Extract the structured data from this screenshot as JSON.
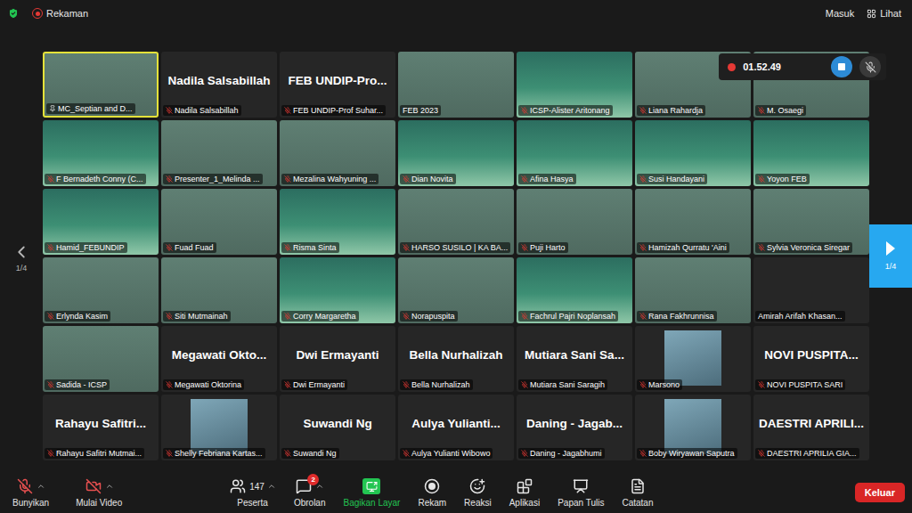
{
  "top_bar": {
    "recording_label": "Rekaman",
    "recording": true,
    "buttons": [
      "Masuk",
      "Lihat"
    ]
  },
  "recording": {
    "time": "01.52.49",
    "recording": true,
    "muted": true
  },
  "pager": {
    "left": "1/4",
    "right": "1/4"
  },
  "tiles": [
    {
      "label": "MC_Septian and D...",
      "kind": "video",
      "speaking": true,
      "pinned": true,
      "muted": false
    },
    {
      "label": "Nadila Salsabillah",
      "name": "Nadila Salsabillah",
      "kind": "name",
      "speaking": false,
      "pinned": false,
      "muted": true
    },
    {
      "label": "FEB UNDIP-Prof Suhar...",
      "name": "FEB UNDIP-Pro...",
      "kind": "name",
      "speaking": false,
      "pinned": false,
      "muted": true
    },
    {
      "label": "FEB 2023",
      "kind": "video",
      "speaking": false,
      "pinned": false,
      "muted": false
    },
    {
      "label": "ICSP-Alister Aritonang",
      "kind": "background",
      "speaking": false,
      "pinned": false,
      "muted": true
    },
    {
      "label": "Liana Rahardja",
      "kind": "video",
      "speaking": false,
      "pinned": false,
      "muted": true
    },
    {
      "label": "M. Osaegi",
      "kind": "video",
      "speaking": false,
      "pinned": false,
      "muted": true
    },
    {
      "label": "F Bernadeth Conny (C...",
      "kind": "background",
      "speaking": false,
      "pinned": false,
      "muted": true
    },
    {
      "label": "Presenter_1_Melinda ...",
      "kind": "video",
      "speaking": false,
      "pinned": false,
      "muted": true
    },
    {
      "label": "Mezalina Wahyuning ...",
      "kind": "video",
      "speaking": false,
      "pinned": false,
      "muted": true
    },
    {
      "label": "Dian Novita",
      "kind": "background",
      "speaking": false,
      "pinned": false,
      "muted": true
    },
    {
      "label": "Afina Hasya",
      "kind": "background",
      "speaking": false,
      "pinned": false,
      "muted": true
    },
    {
      "label": "Susi Handayani",
      "kind": "background",
      "speaking": false,
      "pinned": false,
      "muted": true
    },
    {
      "label": "Yoyon FEB",
      "kind": "background",
      "speaking": false,
      "pinned": false,
      "muted": true
    },
    {
      "label": "Hamid_FEBUNDIP",
      "kind": "background",
      "speaking": false,
      "pinned": false,
      "muted": true
    },
    {
      "label": "Fuad Fuad",
      "kind": "video",
      "speaking": false,
      "pinned": false,
      "muted": true
    },
    {
      "label": "Risma Sinta",
      "kind": "background",
      "speaking": false,
      "pinned": false,
      "muted": true
    },
    {
      "label": "HARSO SUSILO | KA BA...",
      "kind": "video",
      "speaking": false,
      "pinned": false,
      "muted": true
    },
    {
      "label": "Puji Harto",
      "kind": "video",
      "speaking": false,
      "pinned": false,
      "muted": true
    },
    {
      "label": "Hamizah Qurratu 'Aini",
      "kind": "video",
      "speaking": false,
      "pinned": false,
      "muted": true
    },
    {
      "label": "Sylvia Veronica Siregar",
      "kind": "video",
      "speaking": false,
      "pinned": false,
      "muted": true
    },
    {
      "label": "Erlynda Kasim",
      "kind": "video",
      "speaking": false,
      "pinned": false,
      "muted": true
    },
    {
      "label": "Siti Mutmainah",
      "kind": "video",
      "speaking": false,
      "pinned": false,
      "muted": true
    },
    {
      "label": "Corry Margaretha",
      "kind": "background",
      "speaking": false,
      "pinned": false,
      "muted": true
    },
    {
      "label": "Norapuspita",
      "kind": "video",
      "speaking": false,
      "pinned": false,
      "muted": true
    },
    {
      "label": "Fachrul Pajri Noplansah",
      "kind": "background",
      "speaking": false,
      "pinned": false,
      "muted": true
    },
    {
      "label": "Rana Fakhrunnisa",
      "kind": "video",
      "speaking": false,
      "pinned": false,
      "muted": true
    },
    {
      "label": "Amirah Arifah Khasan...",
      "kind": "blank",
      "speaking": false,
      "pinned": false,
      "muted": false
    },
    {
      "label": "Sadida - ICSP",
      "kind": "video",
      "speaking": false,
      "pinned": false,
      "muted": true
    },
    {
      "label": "Megawati Oktorina",
      "name": "Megawati Okto...",
      "kind": "name",
      "speaking": false,
      "pinned": false,
      "muted": true
    },
    {
      "label": "Dwi Ermayanti",
      "name": "Dwi Ermayanti",
      "kind": "name",
      "speaking": false,
      "pinned": false,
      "muted": true
    },
    {
      "label": "Bella Nurhalizah",
      "name": "Bella Nurhalizah",
      "kind": "name",
      "speaking": false,
      "pinned": false,
      "muted": true
    },
    {
      "label": "Mutiara Sani Saragih",
      "name": "Mutiara Sani Sa...",
      "kind": "name",
      "speaking": false,
      "pinned": false,
      "muted": true
    },
    {
      "label": "Marsono",
      "kind": "avatar",
      "speaking": false,
      "pinned": false,
      "muted": true
    },
    {
      "label": "NOVI PUSPITA SARI",
      "name": "NOVI PUSPITA...",
      "kind": "name",
      "speaking": false,
      "pinned": false,
      "muted": true
    },
    {
      "label": "Rahayu Safitri Mutmai...",
      "name": "Rahayu Safitri...",
      "kind": "name",
      "speaking": false,
      "pinned": false,
      "muted": true
    },
    {
      "label": "Shelly Febriana Kartas...",
      "kind": "avatar",
      "speaking": false,
      "pinned": false,
      "muted": true
    },
    {
      "label": "Suwandi Ng",
      "name": "Suwandi Ng",
      "kind": "name",
      "speaking": false,
      "pinned": false,
      "muted": true
    },
    {
      "label": "Aulya Yulianti Wibowo",
      "name": "Aulya Yulianti...",
      "kind": "name",
      "speaking": false,
      "pinned": false,
      "muted": true
    },
    {
      "label": "Daning - Jagabhumi",
      "name": "Daning - Jagab...",
      "kind": "name",
      "speaking": false,
      "pinned": false,
      "muted": true
    },
    {
      "label": "Boby Wiryawan Saputra",
      "kind": "avatar",
      "speaking": false,
      "pinned": false,
      "muted": true
    },
    {
      "label": "DAESTRI APRILIA GIA...",
      "name": "DAESTRI APRILI...",
      "kind": "name",
      "speaking": false,
      "pinned": false,
      "muted": true
    }
  ],
  "toolbar": {
    "left": [
      {
        "label": "Bunyikan",
        "off": true,
        "menu": true
      },
      {
        "label": "Mulai Video",
        "off": true,
        "menu": true
      }
    ],
    "center": [
      {
        "label": "Peserta",
        "count": "147",
        "badge": "",
        "menu": true,
        "active": false
      },
      {
        "label": "Obrolan",
        "count": "",
        "badge": "2",
        "menu": true,
        "active": false
      },
      {
        "label": "Bagikan Layar",
        "count": "",
        "badge": "",
        "menu": false,
        "active": true
      },
      {
        "label": "Rekam",
        "count": "",
        "badge": "",
        "menu": false,
        "active": false
      },
      {
        "label": "Reaksi",
        "count": "",
        "badge": "",
        "menu": false,
        "active": false
      },
      {
        "label": "Aplikasi",
        "count": "",
        "badge": "",
        "menu": false,
        "active": false
      },
      {
        "label": "Papan Tulis",
        "count": "",
        "badge": "",
        "menu": false,
        "active": false
      },
      {
        "label": "Catatan",
        "count": "",
        "badge": "",
        "menu": false,
        "active": false
      }
    ],
    "leave": "Keluar"
  }
}
